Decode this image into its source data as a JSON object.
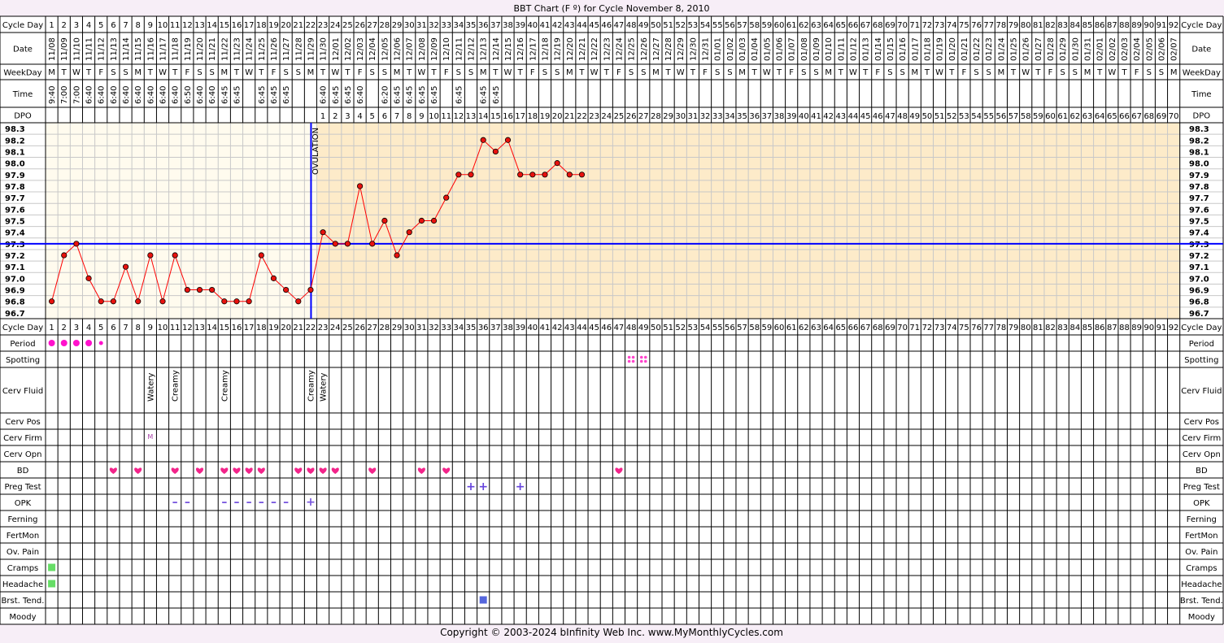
{
  "title": "BBT Chart (F º) for Cycle November 8, 2010",
  "copyright": "Copyright © 2003-2024 bInfinity Web Inc.      www.MyMonthlyCycles.com",
  "colors": {
    "follicular_bg": "#fffbee",
    "luteal_bg": "#fdebc9",
    "line": "#ff0000",
    "point_fill": "#e8120e",
    "coverline": "#0000ff",
    "ovulation": "#0000ff",
    "period": "#ff11cc",
    "spotting": "#ff44cc",
    "heart": "#f2248a",
    "plus": "#6644dd",
    "minus": "#7755dd",
    "symptom_green": "#66dd66",
    "symptom_blue": "#5566dd"
  },
  "labels": {
    "cycle_day": "Cycle Day",
    "date": "Date",
    "weekday": "WeekDay",
    "time": "Time",
    "dpo": "DPO",
    "period": "Period",
    "spotting": "Spotting",
    "cerv_fluid": "Cerv Fluid",
    "cerv_pos": "Cerv Pos",
    "cerv_firm": "Cerv Firm",
    "cerv_opn": "Cerv Opn",
    "bd": "BD",
    "preg_test": "Preg Test",
    "opk": "OPK",
    "ferning": "Ferning",
    "fertmon": "FertMon",
    "ov_pain": "Ov. Pain",
    "cramps": "Cramps",
    "headache": "Headache",
    "brst_tend": "Brst. Tend.",
    "moody": "Moody",
    "ovulation": "OVULATION"
  },
  "dates": [
    "11/08",
    "11/09",
    "11/10",
    "11/11",
    "11/12",
    "11/13",
    "11/14",
    "11/15",
    "11/16",
    "11/17",
    "11/18",
    "11/19",
    "11/20",
    "11/21",
    "11/22",
    "11/23",
    "11/24",
    "11/25",
    "11/26",
    "11/27",
    "11/28",
    "11/29",
    "11/30",
    "12/01",
    "12/02",
    "12/03",
    "12/04",
    "12/05",
    "12/06",
    "12/07",
    "12/08",
    "12/09",
    "12/10",
    "12/11",
    "12/12",
    "12/13",
    "12/14",
    "12/15",
    "12/16",
    "12/17",
    "12/18",
    "12/19",
    "12/20",
    "12/21",
    "12/22",
    "12/23",
    "12/24",
    "12/25",
    "12/26",
    "12/27",
    "12/28",
    "12/29",
    "12/30",
    "12/31",
    "01/01",
    "01/02",
    "01/03",
    "01/04",
    "01/05",
    "01/06",
    "01/07",
    "01/08",
    "01/09",
    "01/10",
    "01/11",
    "01/12",
    "01/13",
    "01/14",
    "01/15",
    "01/16",
    "01/17",
    "01/18",
    "01/19",
    "01/20",
    "01/21",
    "01/22",
    "01/23",
    "01/24",
    "01/25",
    "01/26",
    "01/27",
    "01/28",
    "01/29",
    "01/30",
    "01/31",
    "02/01",
    "02/02",
    "02/03",
    "02/04",
    "02/05",
    "02/06",
    "02/07"
  ],
  "weekdays": [
    "M",
    "T",
    "W",
    "T",
    "F",
    "S",
    "S"
  ],
  "times": [
    "9:40",
    "7:00",
    "7:00",
    "6:40",
    "6:40",
    "6:40",
    "6:40",
    "6:40",
    "6:40",
    "6:40",
    "6:40",
    "6:50",
    "6:40",
    "6:40",
    "6:45",
    "6:45",
    "",
    "6:45",
    "6:45",
    "6:45",
    "",
    "",
    "6:40",
    "6:45",
    "6:45",
    "6:40",
    "",
    "6:20",
    "6:45",
    "6:45",
    "6:45",
    "6:45",
    "",
    "6:45",
    "",
    "6:45",
    "6:45",
    "",
    "",
    "",
    "",
    "",
    "",
    "",
    "",
    "",
    "",
    "",
    "",
    "",
    "",
    "",
    "",
    "",
    "",
    "",
    "",
    "",
    "",
    "",
    "",
    "",
    "",
    "",
    "",
    "",
    "",
    "",
    "",
    "",
    "",
    "",
    "",
    "",
    "",
    "",
    "",
    "",
    "",
    "",
    "",
    "",
    "",
    "",
    "",
    "",
    "",
    "",
    "",
    "",
    "",
    "",
    ""
  ],
  "chart_data": {
    "type": "line",
    "title": "BBT Chart (F º) for Cycle November 8, 2010",
    "xlabel": "Cycle Day",
    "ylabel": "",
    "x": [
      1,
      2,
      3,
      4,
      5,
      6,
      7,
      8,
      9,
      10,
      11,
      12,
      13,
      14,
      15,
      16,
      17,
      18,
      19,
      20,
      21,
      22,
      23,
      24,
      25,
      26,
      27,
      28,
      29,
      30,
      31,
      32,
      33,
      34,
      35,
      36,
      37,
      38,
      39,
      40,
      41,
      42,
      43,
      44
    ],
    "series": [
      {
        "values": [
          96.8,
          97.2,
          97.3,
          97.0,
          96.8,
          96.8,
          97.1,
          96.8,
          97.2,
          96.8,
          97.2,
          96.9,
          96.9,
          96.9,
          96.8,
          96.8,
          96.8,
          97.2,
          97.0,
          96.9,
          96.8,
          96.9,
          97.4,
          97.3,
          97.3,
          97.8,
          97.3,
          97.5,
          97.2,
          97.4,
          97.5,
          97.5,
          97.7,
          97.9,
          97.9,
          98.2,
          98.1,
          98.2,
          97.9,
          97.9,
          97.9,
          98.0,
          97.9,
          97.9
        ]
      }
    ],
    "xlim": [
      1,
      92
    ],
    "ylim": [
      96.7,
      98.3
    ],
    "yticks": [
      "98.3",
      "98.2",
      "98.1",
      "98.0",
      "97.9",
      "97.8",
      "97.7",
      "97.6",
      "97.5",
      "97.4",
      "97.3",
      "97.2",
      "97.1",
      "97.0",
      "96.9",
      "96.8",
      "96.7"
    ],
    "coverline": 97.3,
    "ovulation_day": 22,
    "dpo_start_day": 23,
    "dpo_max": 70,
    "total_days": 92
  },
  "observations": {
    "period": [
      {
        "day": 1,
        "size": "large"
      },
      {
        "day": 2,
        "size": "large"
      },
      {
        "day": 3,
        "size": "large"
      },
      {
        "day": 4,
        "size": "large"
      },
      {
        "day": 5,
        "size": "small"
      }
    ],
    "spotting": [
      48,
      49
    ],
    "cerv_fluid": [
      {
        "day": 9,
        "text": "Watery"
      },
      {
        "day": 11,
        "text": "Creamy"
      },
      {
        "day": 15,
        "text": "Creamy"
      },
      {
        "day": 22,
        "text": "Creamy"
      },
      {
        "day": 23,
        "text": "Watery"
      }
    ],
    "cerv_firm": [
      {
        "day": 9,
        "text": "M"
      }
    ],
    "bd": [
      6,
      8,
      11,
      13,
      15,
      16,
      17,
      18,
      21,
      22,
      23,
      24,
      27,
      31,
      33,
      47
    ],
    "preg_test": [
      {
        "day": 35,
        "text": "+"
      },
      {
        "day": 36,
        "text": "+"
      },
      {
        "day": 39,
        "text": "+"
      }
    ],
    "opk": [
      {
        "day": 11,
        "text": "–"
      },
      {
        "day": 12,
        "text": "–"
      },
      {
        "day": 15,
        "text": "–"
      },
      {
        "day": 16,
        "text": "–"
      },
      {
        "day": 17,
        "text": "–"
      },
      {
        "day": 18,
        "text": "–"
      },
      {
        "day": 19,
        "text": "–"
      },
      {
        "day": 20,
        "text": "–"
      },
      {
        "day": 22,
        "text": "+"
      }
    ],
    "cramps": [
      1
    ],
    "headache": [
      1
    ],
    "brst_tend": [
      36
    ]
  }
}
